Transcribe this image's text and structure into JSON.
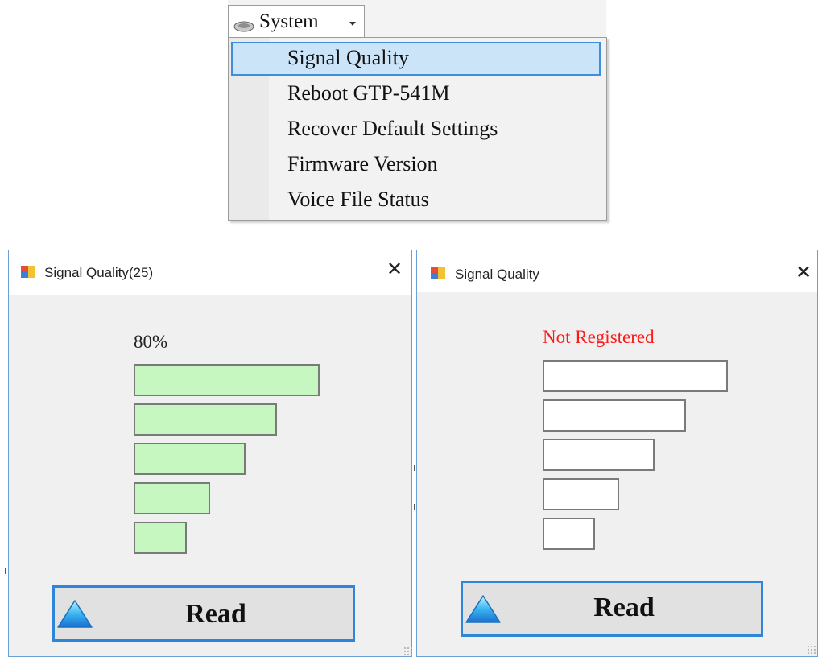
{
  "menu": {
    "system_label": "System",
    "icon": "system-icon",
    "items": [
      {
        "label": "Signal Quality",
        "highlighted": true
      },
      {
        "label": "Reboot GTP-541M",
        "highlighted": false
      },
      {
        "label": "Recover Default Settings",
        "highlighted": false
      },
      {
        "label": "Firmware Version",
        "highlighted": false
      },
      {
        "label": "Voice File Status",
        "highlighted": false
      }
    ]
  },
  "dialog_left": {
    "title": "Signal Quality(25)",
    "close": "✕",
    "percent": "80%",
    "bars_lit": 5,
    "button_label": "Read"
  },
  "dialog_right": {
    "title": "Signal Quality",
    "close": "✕",
    "status": "Not Registered",
    "bars_lit": 0,
    "button_label": "Read"
  },
  "colors": {
    "bar_on": "#c6f7c0",
    "bar_off": "#ffffff",
    "status_red": "#ff1a1a",
    "button_border": "#2f86d8",
    "menu_highlight": "#cce4f7"
  }
}
